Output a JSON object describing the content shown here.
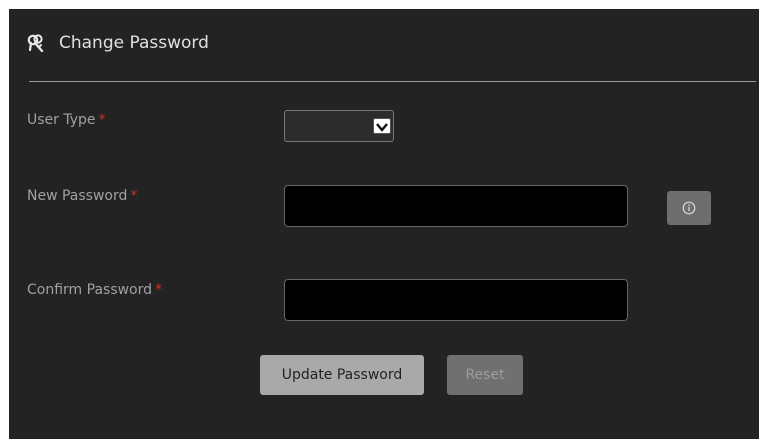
{
  "header": {
    "title": "Change Password",
    "icon": "keys-icon"
  },
  "form": {
    "required_marker": "*",
    "user_type": {
      "label": "User Type",
      "value": ""
    },
    "new_password": {
      "label": "New Password",
      "value": "",
      "info_icon": "info-icon"
    },
    "confirm_password": {
      "label": "Confirm Password",
      "value": ""
    }
  },
  "buttons": {
    "update_label": "Update Password",
    "reset_label": "Reset"
  },
  "colors": {
    "panel_bg": "#232323",
    "required": "#c0392b",
    "input_bg": "#000000",
    "primary_button": "#a9a9a9",
    "disabled_button": "#707070"
  }
}
